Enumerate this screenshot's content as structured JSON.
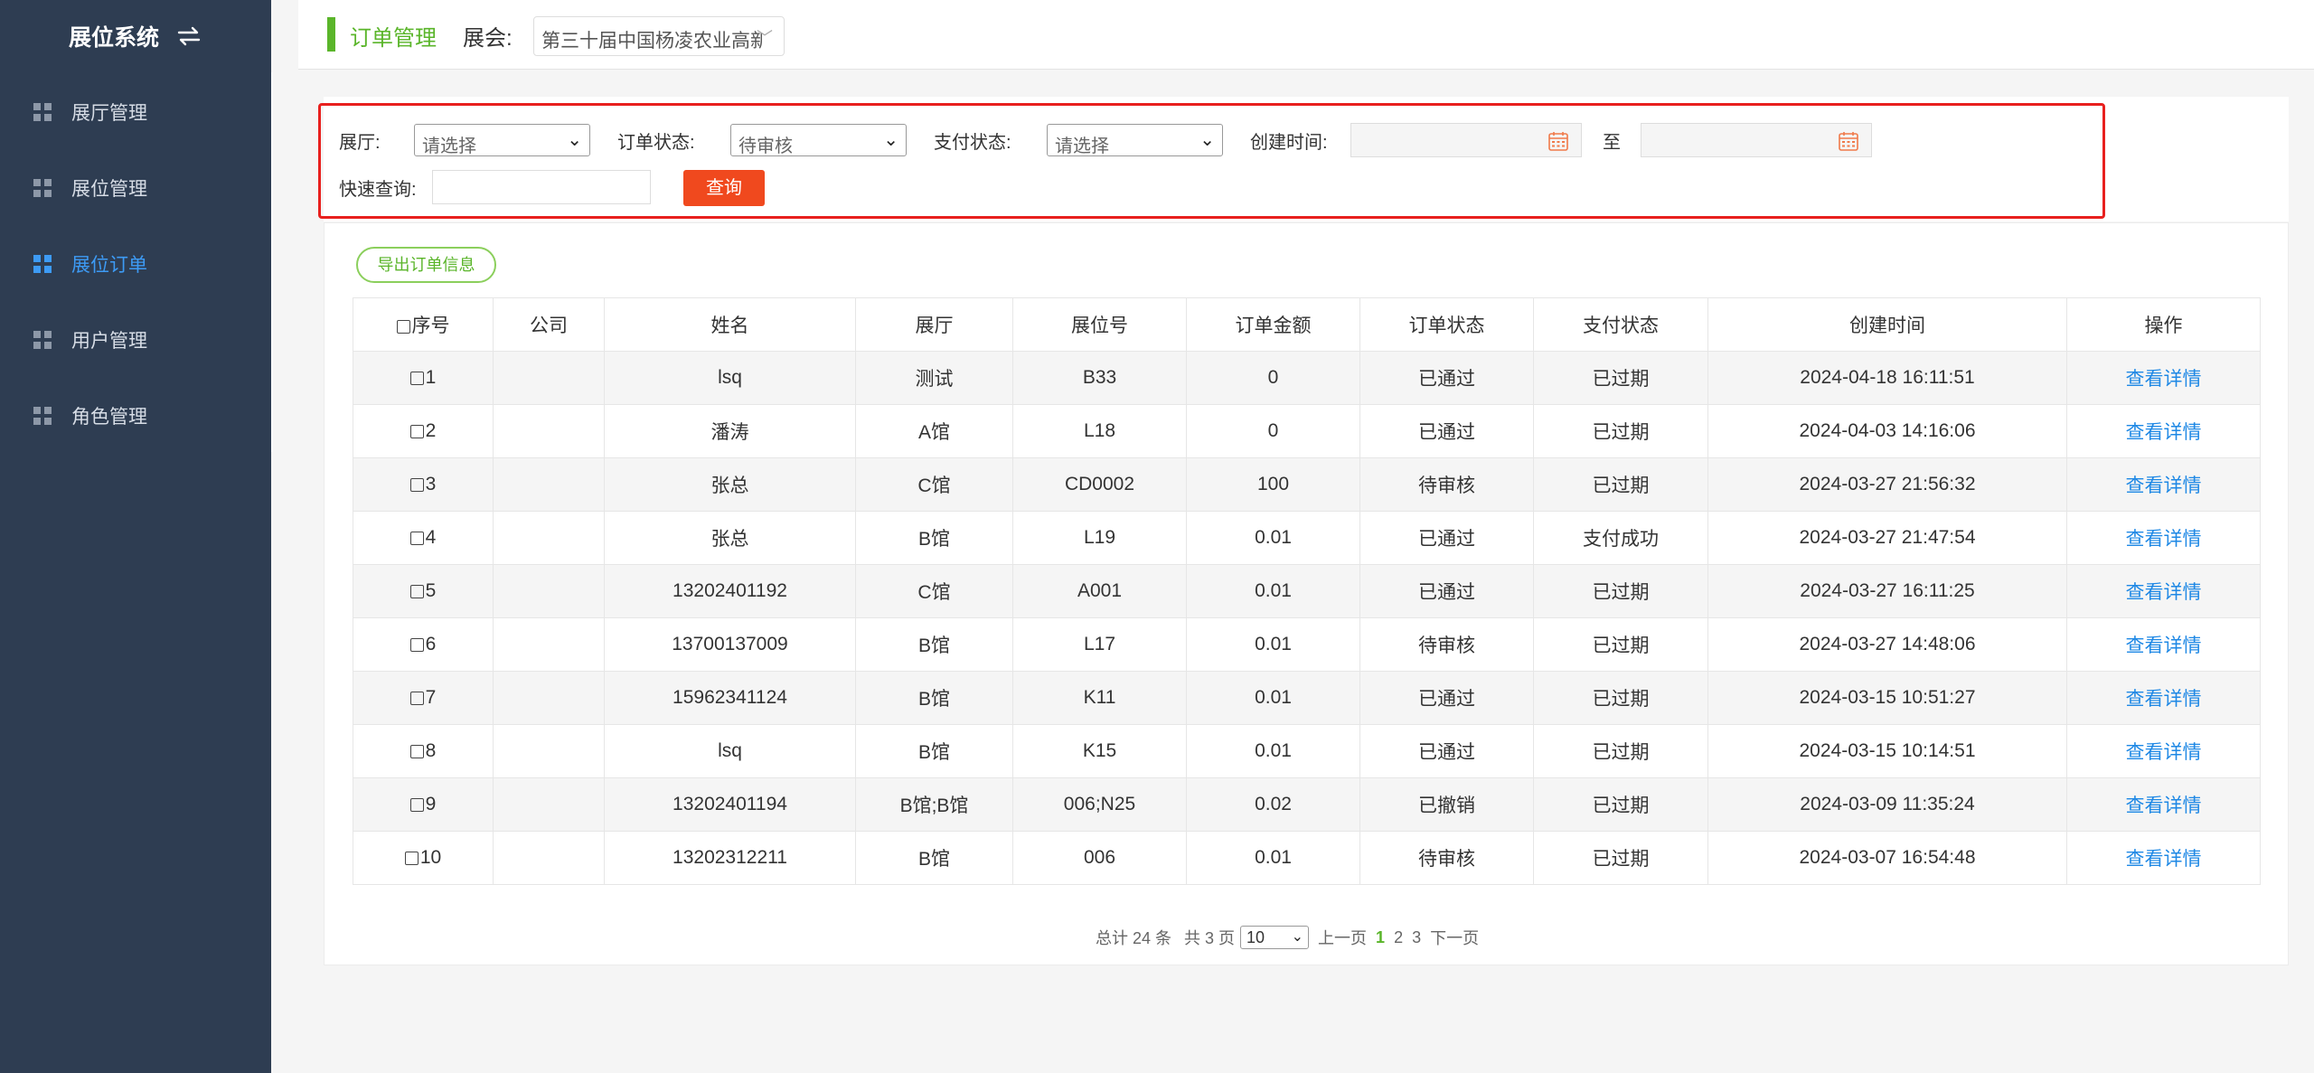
{
  "sidebar": {
    "brand": "展位系统",
    "items": [
      {
        "label": "展厅管理",
        "active": false
      },
      {
        "label": "展位管理",
        "active": false
      },
      {
        "label": "展位订单",
        "active": true
      },
      {
        "label": "用户管理",
        "active": false
      },
      {
        "label": "角色管理",
        "active": false
      }
    ]
  },
  "header": {
    "title": "订单管理",
    "expo_label": "展会:",
    "expo_value": "第三十届中国杨凌农业高新"
  },
  "filters": {
    "hall_label": "展厅:",
    "hall_value": "请选择",
    "order_status_label": "订单状态:",
    "order_status_value": "待审核",
    "pay_status_label": "支付状态:",
    "pay_status_value": "请选择",
    "created_label": "创建时间:",
    "to_label": "至",
    "quick_label": "快速查询:",
    "query_button": "查询"
  },
  "export_button": "导出订单信息",
  "table": {
    "headers": [
      "序号",
      "公司",
      "姓名",
      "展厅",
      "展位号",
      "订单金额",
      "订单状态",
      "支付状态",
      "创建时间",
      "操作"
    ],
    "rows": [
      [
        "1",
        "",
        "lsq",
        "测试",
        "B33",
        "0",
        "已通过",
        "已过期",
        "2024-04-18 16:11:51",
        "查看详情"
      ],
      [
        "2",
        "",
        "潘涛",
        "A馆",
        "L18",
        "0",
        "已通过",
        "已过期",
        "2024-04-03 14:16:06",
        "查看详情"
      ],
      [
        "3",
        "",
        "张总",
        "C馆",
        "CD0002",
        "100",
        "待审核",
        "已过期",
        "2024-03-27 21:56:32",
        "查看详情"
      ],
      [
        "4",
        "",
        "张总",
        "B馆",
        "L19",
        "0.01",
        "已通过",
        "支付成功",
        "2024-03-27 21:47:54",
        "查看详情"
      ],
      [
        "5",
        "",
        "13202401192",
        "C馆",
        "A001",
        "0.01",
        "已通过",
        "已过期",
        "2024-03-27 16:11:25",
        "查看详情"
      ],
      [
        "6",
        "",
        "13700137009",
        "B馆",
        "L17",
        "0.01",
        "待审核",
        "已过期",
        "2024-03-27 14:48:06",
        "查看详情"
      ],
      [
        "7",
        "",
        "15962341124",
        "B馆",
        "K11",
        "0.01",
        "已通过",
        "已过期",
        "2024-03-15 10:51:27",
        "查看详情"
      ],
      [
        "8",
        "",
        "lsq",
        "B馆",
        "K15",
        "0.01",
        "已通过",
        "已过期",
        "2024-03-15 10:14:51",
        "查看详情"
      ],
      [
        "9",
        "",
        "13202401194",
        "B馆;B馆",
        "006;N25",
        "0.02",
        "已撤销",
        "已过期",
        "2024-03-09 11:35:24",
        "查看详情"
      ],
      [
        "10",
        "",
        "13202312211",
        "B馆",
        "006",
        "0.01",
        "待审核",
        "已过期",
        "2024-03-07 16:54:48",
        "查看详情"
      ]
    ]
  },
  "pagination": {
    "total_text": "总计 24 条",
    "pages_text": "共 3 页",
    "page_size": "10",
    "prev": "上一页",
    "pages": [
      "1",
      "2",
      "3"
    ],
    "current": "1",
    "next": "下一页"
  },
  "colors": {
    "sidebar_bg": "#2e3d52",
    "accent_green": "#5ab52a",
    "active_blue": "#3d9bf5",
    "query_button": "#f0491e",
    "highlight_red": "#e8201e",
    "link_blue": "#1e88e5"
  }
}
